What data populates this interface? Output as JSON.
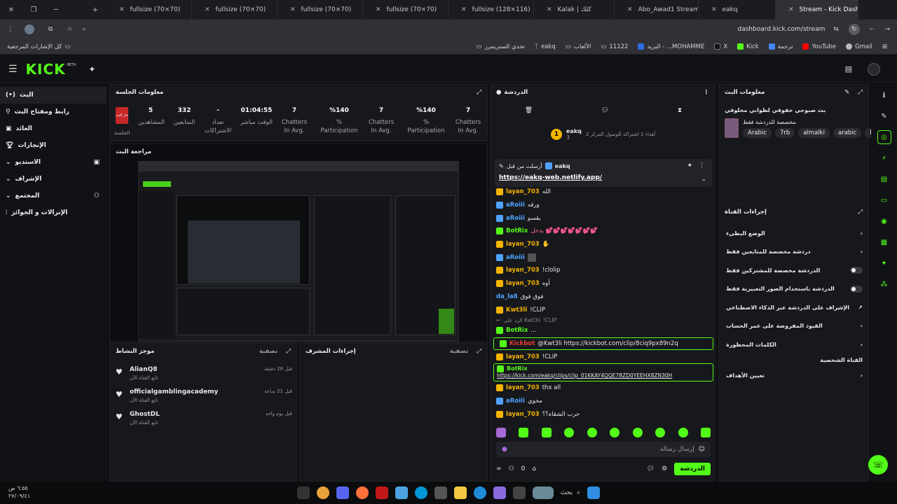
{
  "browser": {
    "tabs": [
      {
        "label": "fullsize (70×70)"
      },
      {
        "label": "fullsize (70×70)"
      },
      {
        "label": "fullsize (70×70)"
      },
      {
        "label": "fullsize (70×70)"
      },
      {
        "label": "fullsize (128×116)"
      },
      {
        "label": "Kalak | كلك"
      },
      {
        "label": "Abo_Awad1 Stream"
      },
      {
        "label": "eakq"
      },
      {
        "label": "Stream - Kick Dashb"
      }
    ],
    "url": "dashboard.kick.com/stream",
    "bookmarks": [
      {
        "label": "Gmail"
      },
      {
        "label": "YouTube"
      },
      {
        "label": "ترجمة"
      },
      {
        "label": "Kick"
      },
      {
        "label": "X"
      },
      {
        "label": "البريد - ...MOHAMME"
      },
      {
        "label": "11122"
      },
      {
        "label": "الألعاب"
      },
      {
        "label": "eakq"
      },
      {
        "label": "تحدي الستريمرز"
      }
    ],
    "all_bookmarks": "كل الإشارات المرجعية"
  },
  "kick": {
    "logo": "KICK",
    "beta": "BETA"
  },
  "sidebar": {
    "items": [
      {
        "label": "البث",
        "icon": "broadcast-icon"
      },
      {
        "label": "رابط ومفتاح البث",
        "icon": "key-icon"
      },
      {
        "label": "العائد",
        "icon": "revenue-icon"
      },
      {
        "label": "الإنجازات",
        "icon": "trophy-icon"
      },
      {
        "label": "الاستديو",
        "icon": "studio-icon"
      },
      {
        "label": "الإشراف",
        "icon": "shield-icon"
      },
      {
        "label": "المجتمع",
        "icon": "people-icon"
      },
      {
        "label": "الإنزالات و الجوائز",
        "icon": "gift-icon"
      }
    ]
  },
  "session": {
    "title": "معلومات الجلسة",
    "live_badge": "جار البث",
    "live_label": "الجلسة",
    "stats": [
      {
        "value": "5",
        "label": "المشاهدين"
      },
      {
        "value": "332",
        "label": "المتابعين"
      },
      {
        "value": "-",
        "label": "تعداد الاشتراكات"
      },
      {
        "value": "01:04:55",
        "label": "الوقت مباشر"
      },
      {
        "value": "7",
        "label": "Chatters In Avg."
      },
      {
        "value": "%140",
        "label": "% Participation"
      },
      {
        "value": "7",
        "label": "Chatters In Avg."
      },
      {
        "value": "%140",
        "label": "% Participation"
      },
      {
        "value": "7",
        "label": "Chatters In Avg."
      }
    ]
  },
  "preview": {
    "title": "مراجعة البث"
  },
  "activity": {
    "title": "موجز النشاط",
    "filter": "تصفية",
    "items": [
      {
        "name": "AlianQ8",
        "sub": "تابع القناة الآن",
        "time": "قبل 28 دقيقة"
      },
      {
        "name": "officialgamblingacademy",
        "sub": "تابع القناة الآن",
        "time": "قبل 21 ساعة"
      },
      {
        "name": "GhostDL",
        "sub": "تابع القناة الآن",
        "time": "قبل يوم واحد"
      }
    ]
  },
  "modactions": {
    "title": "إجراءات المشرف",
    "filter": "تصفية"
  },
  "chat": {
    "title": "الدردشة",
    "top_user": "eakq",
    "top_badge": "1",
    "top_sub": "3",
    "top_note": "أهداء 1 اشتراكه للوصول المركز 2",
    "pinned_by": "أرسلت من قبل",
    "pinned_user": "eakq",
    "pinned_link": "https://eakq-web.netlify.app/",
    "messages": [
      {
        "user": "layan_703",
        "text": "الله",
        "color": "#f4b400"
      },
      {
        "user": "aRoiii",
        "text": "ورقه",
        "color": "#4fa3ff"
      },
      {
        "user": "aRoiii",
        "text": "يقسو",
        "color": "#4fa3ff"
      },
      {
        "user": "BotRix",
        "text": "يدخل 💕💕💕💕💕💕💕",
        "color": "#53fc18"
      },
      {
        "user": "layan_703",
        "text": "✋",
        "color": "#f4b400"
      },
      {
        "user": "aRoiii",
        "text": "",
        "color": "#4fa3ff"
      },
      {
        "user": "layan_703",
        "text": "!clolip",
        "color": "#f4b400"
      },
      {
        "user": "layan_703",
        "text": "أوه",
        "color": "#f4b400"
      },
      {
        "user": "da_la8",
        "text": "فوق فوق",
        "color": "#4fa3ff"
      },
      {
        "user": "Kwt3li",
        "text": "!CLIP",
        "color": "#f4b400"
      },
      {
        "user": "الرد على Kwt3li",
        "text": "!CLIP",
        "color": "#888888"
      },
      {
        "user": "BotRix",
        "text": "...",
        "color": "#53fc18"
      },
      {
        "user": "Kickbot",
        "text": "@Kwt3li https://kickbot.com/clip/8ciq9px89n2q",
        "color": "#e53935"
      },
      {
        "user": "layan_703",
        "text": "!CLIP",
        "color": "#f4b400"
      },
      {
        "user": "BotRix",
        "text": "https://kick.com/eakq/clips/clip_01KKAY4QQE78ZD0YEEHX8ZN30H",
        "color": "#53fc18"
      },
      {
        "user": "layan_703",
        "text": "thx all",
        "color": "#f4b400"
      },
      {
        "user": "aRoiii",
        "text": "مخوي",
        "color": "#4fa3ff"
      },
      {
        "user": "layan_703",
        "text": "حرب الشقاه؟؟",
        "color": "#f4b400"
      }
    ],
    "input_placeholder": "إرسال رسالة",
    "send_label": "الدردشة",
    "count": "0"
  },
  "streaminfo": {
    "title": "معلومات البث",
    "stream_title": "بث صبوحي خفوفي لطوابي مخلوفي",
    "category": "مخصصة للدردشة فقط",
    "tags": [
      "Arabic",
      "7rb",
      "almalki",
      "arabic",
      "ksa"
    ]
  },
  "channel": {
    "title": "إجراءات القناة",
    "rows": [
      {
        "label": "الوضع البطيء",
        "control": "chevron"
      },
      {
        "label": "دردشة مخصصة للمتابعين فقط",
        "control": "chevron"
      },
      {
        "label": "الدردشة مخصصة للمشتركين فقط",
        "control": "toggle"
      },
      {
        "label": "الدردشة باستخدام الصور التعبيرية فقط",
        "control": "toggle"
      },
      {
        "label": "الإشراف على الدردشة عبر الذكاء الاصطناعي",
        "control": "external"
      },
      {
        "label": "القيود المفروضة على عمر الحساب",
        "control": "chevron"
      },
      {
        "label": "الكلمات المحظورة",
        "control": "chevron"
      }
    ],
    "section2": "القناة الشخصية",
    "goals": "تعيين الأهداف"
  },
  "taskbar": {
    "search": "بحث",
    "time": "٦:٥٥ ص",
    "date": "٢٧/٠٩/٤١"
  }
}
